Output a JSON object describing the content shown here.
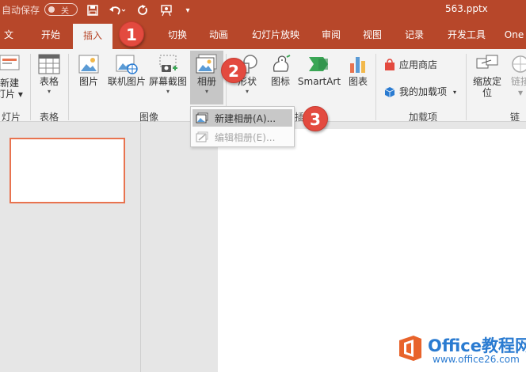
{
  "titlebar": {
    "autosave_label": "自动保存",
    "autosave_state": "关",
    "filename": "563.pptx",
    "quick_access": [
      "save-icon",
      "undo-icon",
      "redo-icon",
      "present-from-start-icon",
      "customize-qat-icon"
    ]
  },
  "tabs": [
    {
      "label": "文件"
    },
    {
      "label": "开始"
    },
    {
      "label": "插入",
      "active": true
    },
    {
      "label": "切换"
    },
    {
      "label": "动画"
    },
    {
      "label": "幻灯片放映"
    },
    {
      "label": "审阅"
    },
    {
      "label": "视图"
    },
    {
      "label": "记录"
    },
    {
      "label": "开发工具"
    },
    {
      "label": "One"
    }
  ],
  "ribbon": {
    "new_slide": {
      "line1": "新建",
      "line2": "灯片 ▾"
    },
    "table": "表格",
    "picture": "图片",
    "online_picture": "联机图片",
    "screenshot": "屏幕截图",
    "album": "相册",
    "shapes": "形状",
    "icons": "图标",
    "smartart": "SmartArt",
    "chart": "图表",
    "app_store": "应用商店",
    "my_addins": "我的加载项",
    "zoom": {
      "line1": "缩放定",
      "line2": "位"
    },
    "link": {
      "line1": "链接",
      "line2": "▾"
    },
    "groups": {
      "slides": "灯片",
      "tables": "表格",
      "images": "图像",
      "illustrations_partial": "插",
      "addins": "加载项",
      "links": "链接"
    }
  },
  "album_menu": {
    "items": [
      {
        "label": "新建相册(A)...",
        "enabled": true,
        "highlighted": true
      },
      {
        "label": "编辑相册(E)...",
        "enabled": false
      }
    ]
  },
  "steps": [
    "1",
    "2",
    "3"
  ],
  "watermark": {
    "title": "Office教程网",
    "url": "www.office26.com"
  },
  "colors": {
    "accent": "#b7472a",
    "badge": "#e34a3f",
    "thumb_border": "#e8734f",
    "watermark": "#2a7bd1"
  }
}
